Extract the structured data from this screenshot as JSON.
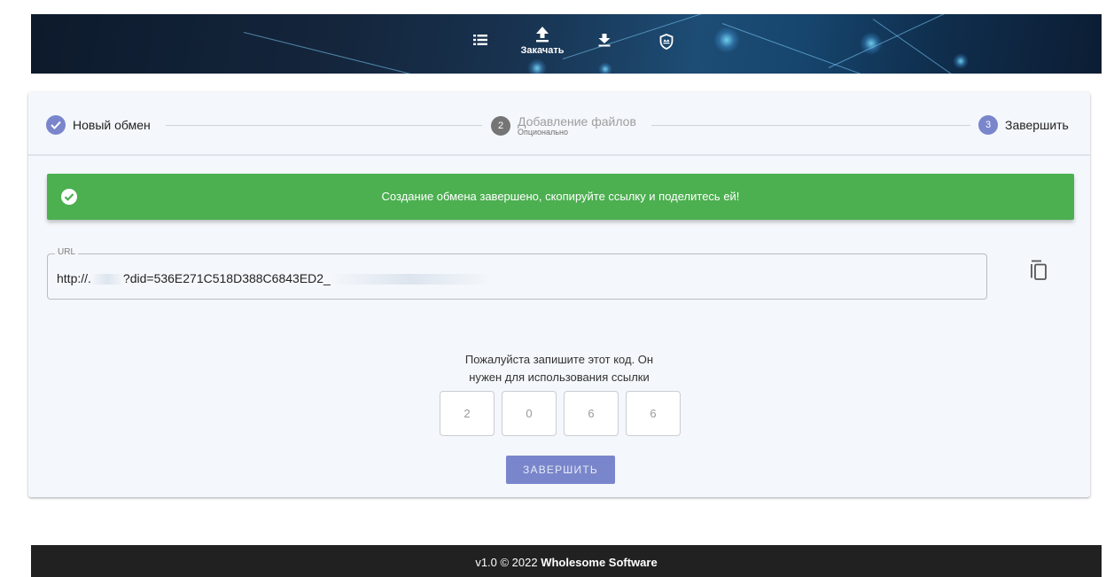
{
  "header": {
    "nav": [
      {
        "icon": "list-icon",
        "label": ""
      },
      {
        "icon": "upload-icon",
        "label": "Закачать"
      },
      {
        "icon": "download-icon",
        "label": ""
      },
      {
        "icon": "shield-icon",
        "label": ""
      }
    ]
  },
  "stepper": {
    "steps": [
      {
        "number": "1",
        "label": "Новый обмен",
        "sublabel": "",
        "state": "completed"
      },
      {
        "number": "2",
        "label": "Добавление файлов",
        "sublabel": "Опционально",
        "state": "inactive"
      },
      {
        "number": "3",
        "label": "Завершить",
        "sublabel": "",
        "state": "active"
      }
    ]
  },
  "alert": {
    "message": "Создание обмена завершено, скопируйте ссылку и поделитесь ей!"
  },
  "url_field": {
    "legend": "URL",
    "value_prefix": "http://.",
    "value_visible": "?did=536E271C518D388C6843ED2_"
  },
  "code": {
    "hint_line1": "Пожалуйста запишите этот код. Он",
    "hint_line2": "нужен для использования ссылки",
    "digits": [
      "2",
      "0",
      "6",
      "6"
    ]
  },
  "actions": {
    "finish_label": "Завершить"
  },
  "footer": {
    "version": "v1.0 © 2022 ",
    "company": "Wholesome Software"
  },
  "colors": {
    "success": "#4caf50",
    "primary": "#7986cb",
    "footer_bg": "#212121"
  }
}
